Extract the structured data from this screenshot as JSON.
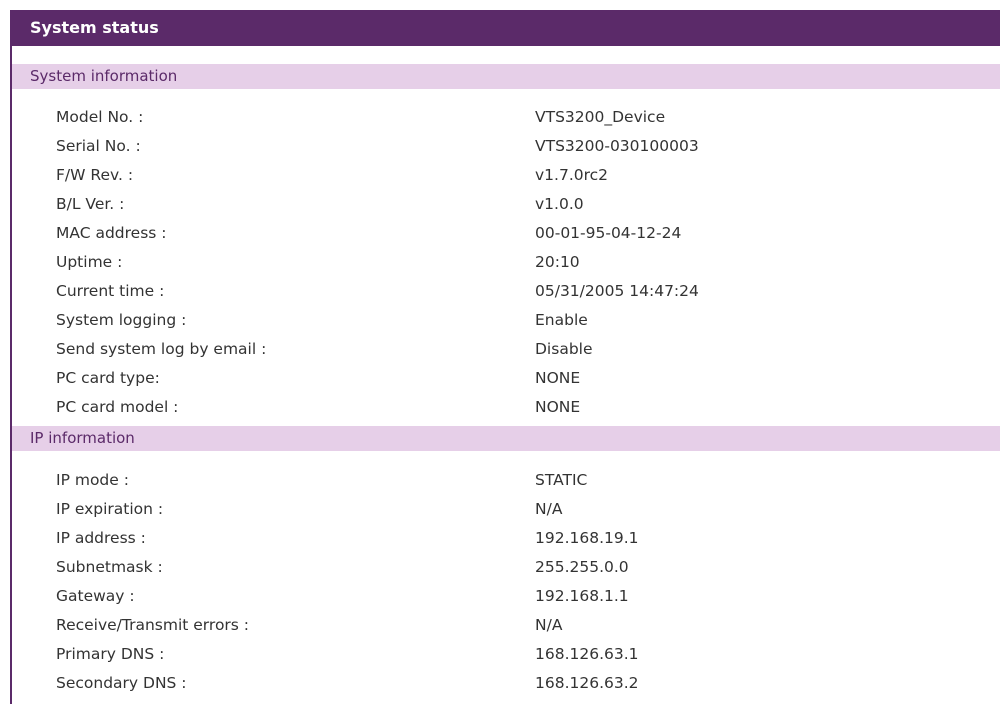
{
  "title": "System status",
  "sections": [
    {
      "title": "System information",
      "rows": [
        {
          "label": "Model No. :",
          "value": "VTS3200_Device"
        },
        {
          "label": "Serial No. :",
          "value": "VTS3200-030100003"
        },
        {
          "label": "F/W Rev. :",
          "value": "v1.7.0rc2"
        },
        {
          "label": "B/L Ver. :",
          "value": "v1.0.0"
        },
        {
          "label": "MAC address :",
          "value": "00-01-95-04-12-24"
        },
        {
          "label": "Uptime :",
          "value": "20:10"
        },
        {
          "label": "Current time :",
          "value": "05/31/2005 14:47:24"
        },
        {
          "label": "System logging :",
          "value": "Enable"
        },
        {
          "label": "Send system log by email :",
          "value": "Disable"
        },
        {
          "label": "PC card type:",
          "value": "NONE"
        },
        {
          "label": "PC card model :",
          "value": "NONE"
        }
      ]
    },
    {
      "title": "IP information",
      "rows": [
        {
          "label": "IP mode :",
          "value": "STATIC"
        },
        {
          "label": "IP expiration :",
          "value": "N/A"
        },
        {
          "label": "IP address :",
          "value": "192.168.19.1"
        },
        {
          "label": "Subnetmask :",
          "value": "255.255.0.0"
        },
        {
          "label": "Gateway :",
          "value": "192.168.1.1"
        },
        {
          "label": "Receive/Transmit errors :",
          "value": "N/A"
        },
        {
          "label": "Primary DNS :",
          "value": "168.126.63.1"
        },
        {
          "label": "Secondary DNS :",
          "value": "168.126.63.2"
        }
      ]
    }
  ],
  "colors": {
    "title_bar": "#5b2a69",
    "section_header": "#e6cfe8",
    "text": "#333333"
  }
}
